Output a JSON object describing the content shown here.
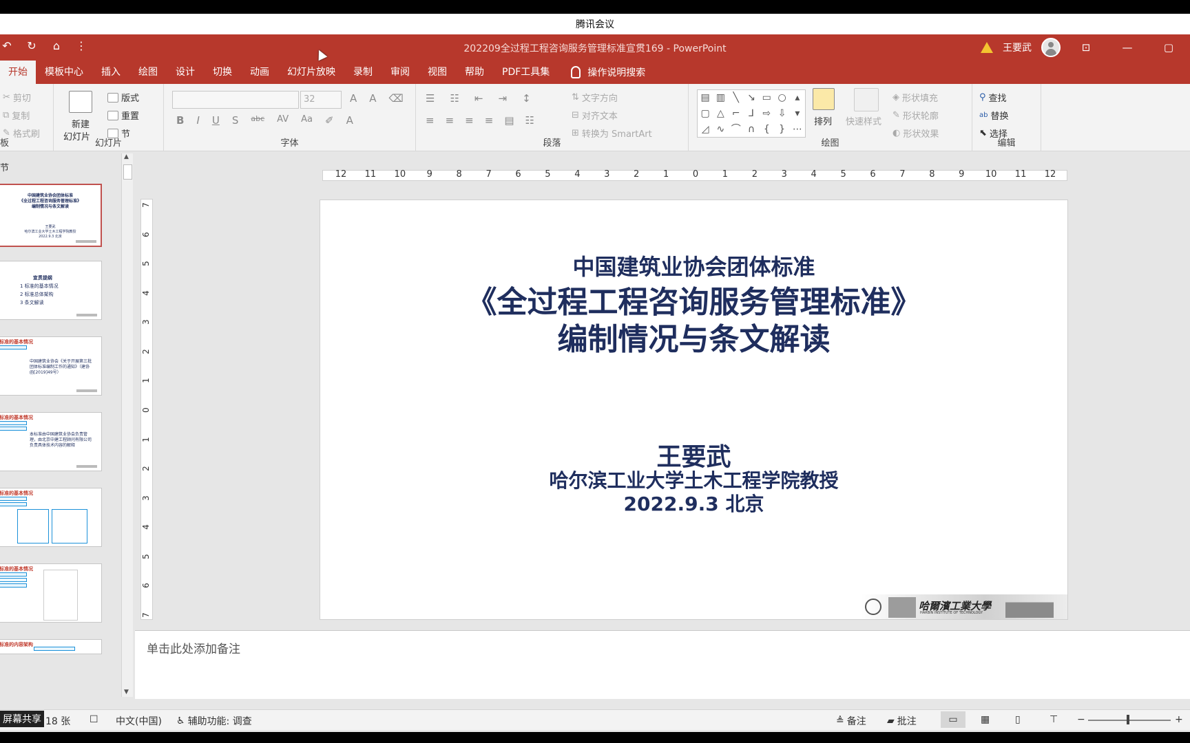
{
  "meeting": {
    "title": "腾讯会议",
    "share_label": "屏幕共享"
  },
  "window": {
    "doc_title": "202209全过程工程咨询服务管理标准宣贯169  -  PowerPoint",
    "user": "王要武",
    "controls": [
      "⊡",
      "—",
      "▢"
    ]
  },
  "qat": [
    "↶",
    "↻",
    "⌂",
    "⋮"
  ],
  "tabs": [
    "开始",
    "模板中心",
    "插入",
    "绘图",
    "设计",
    "切换",
    "动画",
    "幻灯片放映",
    "录制",
    "审阅",
    "视图",
    "帮助",
    "PDF工具集"
  ],
  "tell_me": "操作说明搜索",
  "ribbon": {
    "clipboard": {
      "cut": "剪切",
      "copy": "复制",
      "format_painter": "格式刷",
      "label": "板"
    },
    "slides": {
      "new_slide": "新建",
      "new_slide2": "幻灯片",
      "layout": "版式",
      "reset": "重置",
      "section": "节",
      "label": "幻灯片"
    },
    "font": {
      "size": "32",
      "label": "字体"
    },
    "paragraph": {
      "text_direction": "文字方向",
      "align_text": "对齐文本",
      "smartart": "转换为 SmartArt",
      "label": "段落"
    },
    "drawing": {
      "arrange": "排列",
      "quick_styles": "快速样式",
      "fill": "形状填充",
      "outline": "形状轮廓",
      "effects": "形状效果",
      "label": "绘图"
    },
    "editing": {
      "find": "查找",
      "replace": "替换",
      "select": "选择",
      "label": "编辑"
    }
  },
  "pane": {
    "section_label": "节"
  },
  "thumbnails": [
    {
      "lines": [
        "中国建筑业协会团体标准",
        "《全过程工程咨询服务管理标准》",
        "编制情况与条文解读"
      ],
      "sub": [
        "王要武",
        "哈尔滨工业大学土木工程学院教授",
        "2022.9.3  北京"
      ]
    },
    {
      "title": "宣贯提纲",
      "items": [
        "1  标准的基本情况",
        "2  标准总体架构",
        "3  条文解读"
      ]
    },
    {
      "header": "标准的基本情况",
      "body": "中国建筑业协会《关于开展第三批团体标准编制工作的通知》（建协函[2019]49号）"
    },
    {
      "header": "标准的基本情况",
      "body": "本标准由中国建筑业协会负责管理，由北京中建工程顾问有限公司负责具体技术内容的解释"
    },
    {
      "header": "标准的基本情况",
      "body": ""
    },
    {
      "header": "标准的基本情况",
      "body": ""
    },
    {
      "header": "标准的内容架构",
      "body": ""
    }
  ],
  "slide": {
    "line1": "中国建筑业协会团体标准",
    "line2": "《全过程工程咨询服务管理标准》",
    "line3": "编制情况与条文解读",
    "author": "王要武",
    "affiliation": "哈尔滨工业大学土木工程学院教授",
    "date_place": "2022.9.3  北京",
    "logo_text": "哈爾濱工業大學",
    "logo_sub": "HARBIN INSTITUTE OF TECHNOLOGY"
  },
  "hruler": [
    "12",
    "11",
    "10",
    "9",
    "8",
    "7",
    "6",
    "5",
    "4",
    "3",
    "2",
    "1",
    "0",
    "1",
    "2",
    "3",
    "4",
    "5",
    "6",
    "7",
    "8",
    "9",
    "10",
    "11",
    "12"
  ],
  "vruler": [
    "7",
    "6",
    "5",
    "4",
    "3",
    "2",
    "1",
    "0",
    "1",
    "2",
    "3",
    "4",
    "5",
    "6",
    "7"
  ],
  "notes_placeholder": "单击此处添加备注",
  "status": {
    "slide_count": "18 张",
    "language": "中文(中国)",
    "accessibility": "辅助功能: 调查",
    "notes": "备注",
    "comments": "批注"
  }
}
